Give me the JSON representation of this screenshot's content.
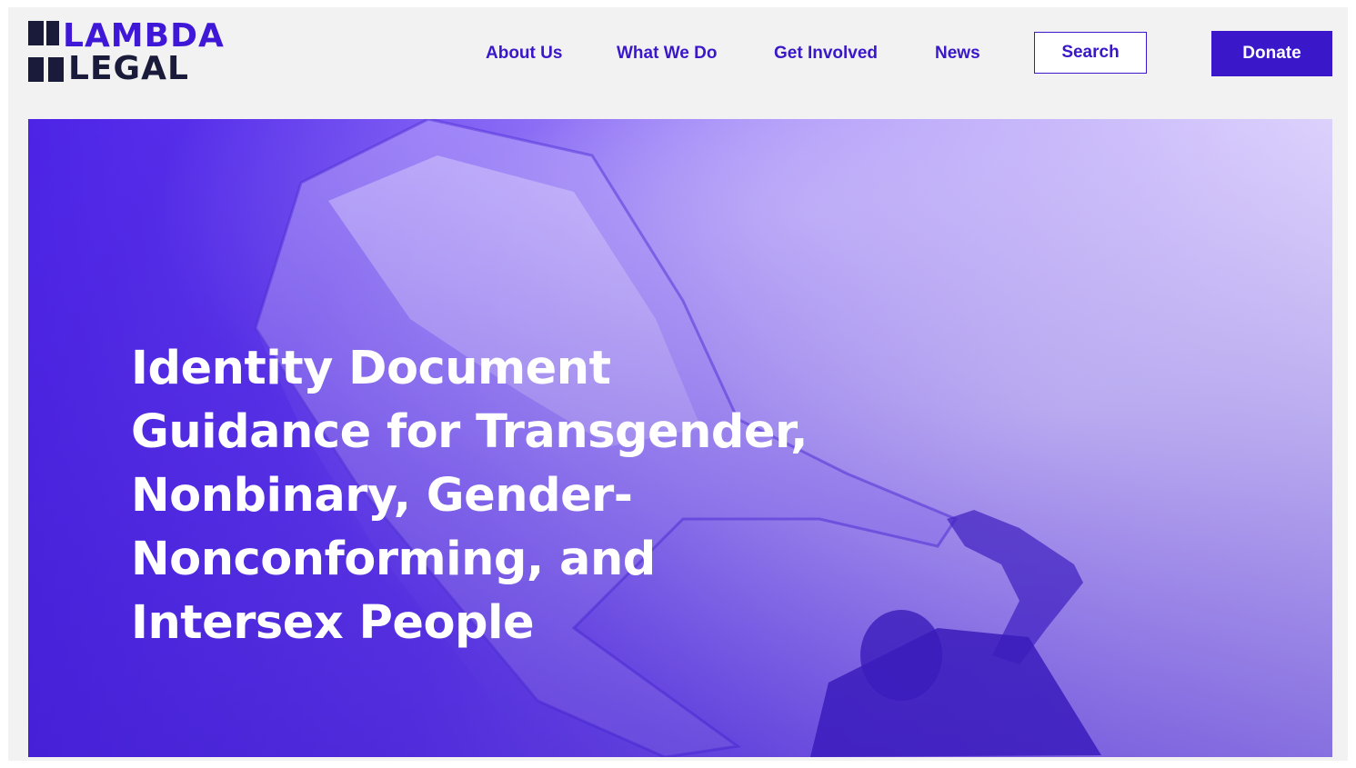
{
  "logo": {
    "line1": "LAMBDA",
    "line2": "LEGAL"
  },
  "nav": {
    "items": [
      {
        "label": "About Us"
      },
      {
        "label": "What We Do"
      },
      {
        "label": "Get Involved"
      },
      {
        "label": "News"
      }
    ],
    "search_label": "Search",
    "donate_label": "Donate"
  },
  "hero": {
    "title": "Identity Document Guidance for Transgender, Nonbinary, Gender-Nonconforming, and Intersex People"
  },
  "colors": {
    "brand": "#3a17c8",
    "logo_dark": "#1a1a3a",
    "header_bg": "#f2f2f2",
    "hero_overlay": "#5a2ef0"
  }
}
